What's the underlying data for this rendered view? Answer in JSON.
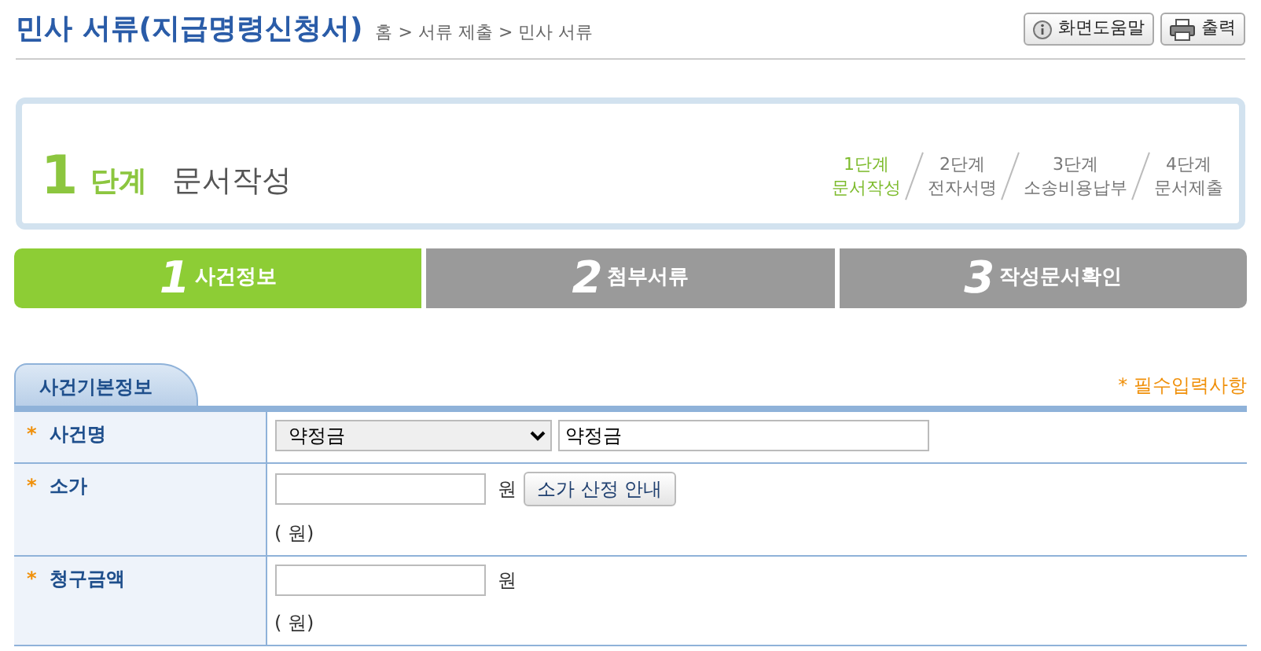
{
  "header": {
    "title": "민사 서류(지급명령신청서)",
    "breadcrumb": "홈 > 서류 제출 > 민사 서류",
    "buttons": [
      {
        "kind": "help",
        "label": "화면도움말"
      },
      {
        "kind": "print",
        "label": "출력"
      }
    ]
  },
  "stage": {
    "number": "1",
    "unit": "단계",
    "name": "문서작성",
    "steps": [
      {
        "step": "1단계",
        "name": "문서작성",
        "selected": true
      },
      {
        "step": "2단계",
        "name": "전자서명",
        "selected": false
      },
      {
        "step": "3단계",
        "name": "소송비용납부",
        "selected": false
      },
      {
        "step": "4단계",
        "name": "문서제출",
        "selected": false
      }
    ]
  },
  "tabs": [
    {
      "number": "1",
      "label": "사건정보",
      "selected": true
    },
    {
      "number": "2",
      "label": "첨부서류",
      "selected": false
    },
    {
      "number": "3",
      "label": "작성문서확인",
      "selected": false
    }
  ],
  "section": {
    "title": "사건기본정보",
    "required_note": "* 필수입력사항"
  },
  "rows": [
    {
      "kind": "select_text",
      "required_mark": "*",
      "label": "사건명",
      "select_value": "약정금",
      "text_value": "약정금"
    },
    {
      "kind": "amount",
      "required_mark": "*",
      "label": "소가",
      "unit": "원",
      "button": "소가 산정 안내",
      "note": "( 원)"
    },
    {
      "kind": "amount",
      "required_mark": "*",
      "label": "청구금액",
      "unit": "원",
      "note": "( 원)"
    }
  ]
}
